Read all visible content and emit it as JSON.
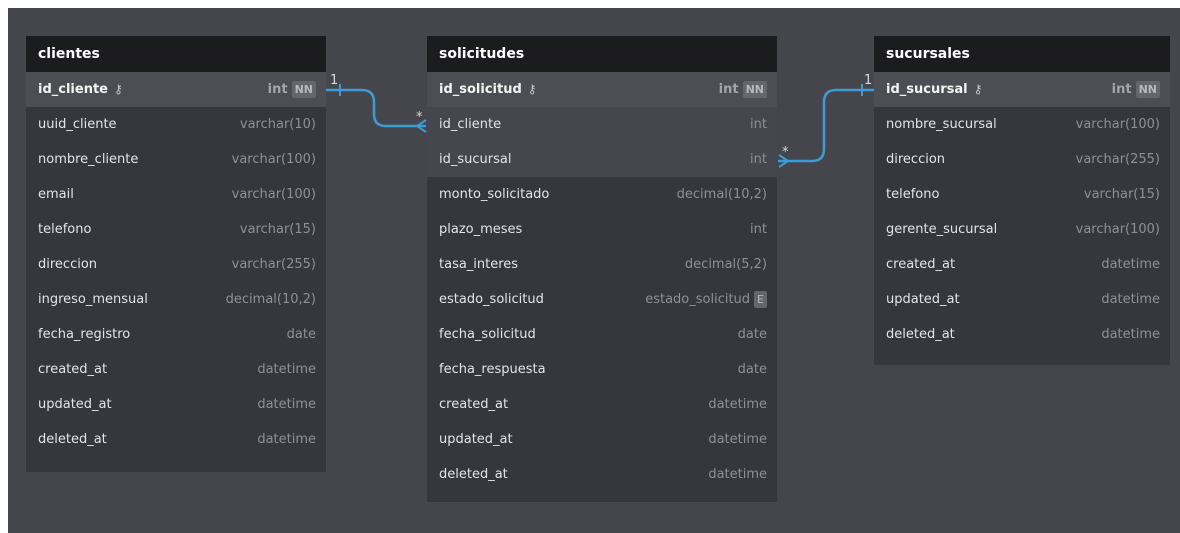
{
  "tables": {
    "clientes": {
      "title": "clientes",
      "rows": [
        {
          "name": "id_cliente",
          "type": "int",
          "badge": "NN"
        },
        {
          "name": "uuid_cliente",
          "type": "varchar(10)"
        },
        {
          "name": "nombre_cliente",
          "type": "varchar(100)"
        },
        {
          "name": "email",
          "type": "varchar(100)"
        },
        {
          "name": "telefono",
          "type": "varchar(15)"
        },
        {
          "name": "direccion",
          "type": "varchar(255)"
        },
        {
          "name": "ingreso_mensual",
          "type": "decimal(10,2)"
        },
        {
          "name": "fecha_registro",
          "type": "date"
        },
        {
          "name": "created_at",
          "type": "datetime"
        },
        {
          "name": "updated_at",
          "type": "datetime"
        },
        {
          "name": "deleted_at",
          "type": "datetime"
        }
      ]
    },
    "solicitudes": {
      "title": "solicitudes",
      "rows": [
        {
          "name": "id_solicitud",
          "type": "int",
          "badge": "NN"
        },
        {
          "name": "id_cliente",
          "type": "int"
        },
        {
          "name": "id_sucursal",
          "type": "int"
        },
        {
          "name": "monto_solicitado",
          "type": "decimal(10,2)"
        },
        {
          "name": "plazo_meses",
          "type": "int"
        },
        {
          "name": "tasa_interes",
          "type": "decimal(5,2)"
        },
        {
          "name": "estado_solicitud",
          "type": "estado_solicitud",
          "badge": "E"
        },
        {
          "name": "fecha_solicitud",
          "type": "date"
        },
        {
          "name": "fecha_respuesta",
          "type": "date"
        },
        {
          "name": "created_at",
          "type": "datetime"
        },
        {
          "name": "updated_at",
          "type": "datetime"
        },
        {
          "name": "deleted_at",
          "type": "datetime"
        }
      ]
    },
    "sucursales": {
      "title": "sucursales",
      "rows": [
        {
          "name": "id_sucursal",
          "type": "int",
          "badge": "NN"
        },
        {
          "name": "nombre_sucursal",
          "type": "varchar(100)"
        },
        {
          "name": "direccion",
          "type": "varchar(255)"
        },
        {
          "name": "telefono",
          "type": "varchar(15)"
        },
        {
          "name": "gerente_sucursal",
          "type": "varchar(100)"
        },
        {
          "name": "created_at",
          "type": "datetime"
        },
        {
          "name": "updated_at",
          "type": "datetime"
        },
        {
          "name": "deleted_at",
          "type": "datetime"
        }
      ]
    }
  },
  "relations": [
    {
      "from_card": "1",
      "to_card": "*"
    },
    {
      "from_card": "1",
      "to_card": "*"
    }
  ],
  "colors": {
    "relation_line": "#3d9bd6"
  }
}
